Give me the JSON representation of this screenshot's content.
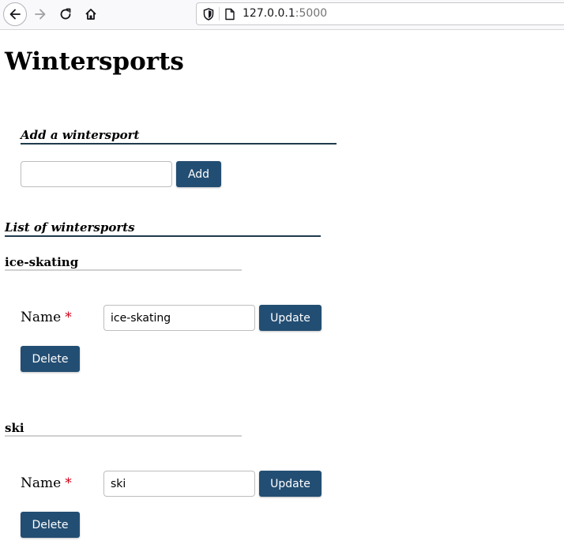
{
  "browser": {
    "url_host": "127.0.0.1",
    "url_port": ":5000"
  },
  "page": {
    "title": "Wintersports",
    "add_section": {
      "title": "Add a wintersport",
      "input_value": "",
      "add_label": "Add"
    },
    "list_section": {
      "title": "List of wintersports",
      "items": [
        {
          "heading": "ice-skating",
          "name_label": "Name",
          "required_mark": "*",
          "value": "ice-skating",
          "update_label": "Update",
          "delete_label": "Delete"
        },
        {
          "heading": "ski",
          "name_label": "Name",
          "required_mark": "*",
          "value": "ski",
          "update_label": "Update",
          "delete_label": "Delete"
        }
      ]
    }
  },
  "colors": {
    "button_bg": "#234e73",
    "required": "#d0021b"
  }
}
